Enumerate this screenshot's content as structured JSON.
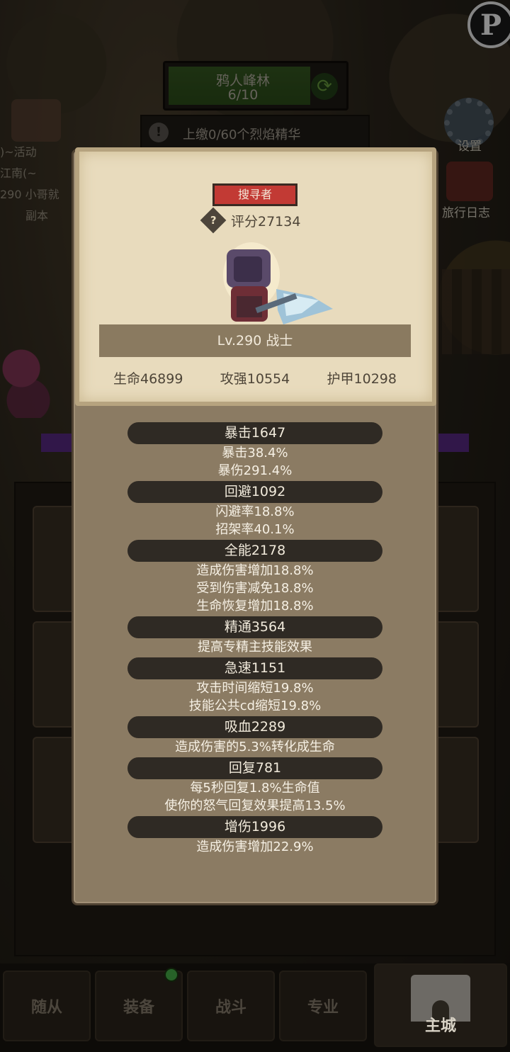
{
  "background": {
    "map_name": "鸦人峰林",
    "map_progress": "6/10",
    "submit_text": "上缴0/60个烈焰精华",
    "left_lines": [
      ")~活动",
      "江南(~",
      "290 小哥就",
      "副本"
    ],
    "settings_label": "设置",
    "journal_label": "旅行日志",
    "top_logo": "P"
  },
  "bottom_nav": {
    "tabs": [
      "随从",
      "装备",
      "战斗",
      "专业"
    ],
    "home": "主城"
  },
  "hero": {
    "role_tag": "搜寻者",
    "score": "评分27134",
    "level_class": "Lv.290 战士",
    "stats": [
      "生命46899",
      "攻强10554",
      "护甲10298"
    ]
  },
  "attributes": [
    {
      "header": "暴击1647",
      "lines": [
        "暴击38.4%",
        "暴伤291.4%"
      ]
    },
    {
      "header": "回避1092",
      "lines": [
        "闪避率18.8%",
        "招架率40.1%"
      ]
    },
    {
      "header": "全能2178",
      "lines": [
        "造成伤害增加18.8%",
        "受到伤害减免18.8%",
        "生命恢复增加18.8%"
      ]
    },
    {
      "header": "精通3564",
      "lines": [
        "提高专精主技能效果"
      ]
    },
    {
      "header": "急速1151",
      "lines": [
        "攻击时间缩短19.8%",
        "技能公共cd缩短19.8%"
      ]
    },
    {
      "header": "吸血2289",
      "lines": [
        "造成伤害的5.3%转化成生命"
      ]
    },
    {
      "header": "回复781",
      "lines": [
        "每5秒回复1.8%生命值",
        "使你的怒气回复效果提高13.5%"
      ]
    },
    {
      "header": "增伤1996",
      "lines": [
        "造成伤害增加22.9%"
      ]
    }
  ]
}
